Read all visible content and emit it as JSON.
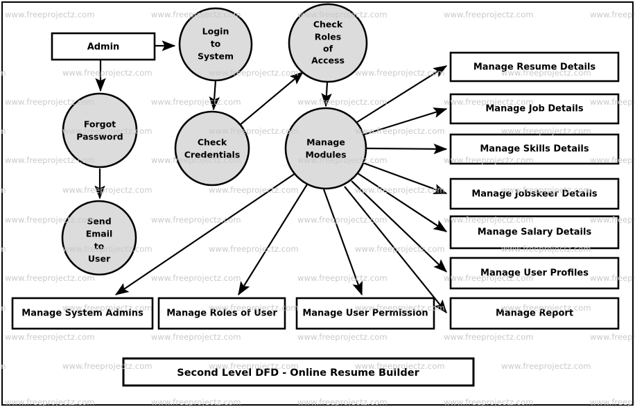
{
  "diagram": {
    "title": "Second Level DFD - Online Resume Builder",
    "watermark": "www.freeprojectz.com",
    "colors": {
      "process_fill": "#dcdcdc",
      "entity_fill": "#ffffff",
      "stroke": "#000000",
      "watermark": "#c9c9c9",
      "background": "#ffffff"
    },
    "entities": {
      "admin": "Admin"
    },
    "processes": {
      "login_to_system": [
        "Login",
        "to",
        "System"
      ],
      "check_roles_of_access": [
        "Check",
        "Roles",
        "of",
        "Access"
      ],
      "forgot_password": [
        "Forgot",
        "Password"
      ],
      "check_credentials": [
        "Check",
        "Credentials"
      ],
      "manage_modules": [
        "Manage",
        "Modules"
      ],
      "send_email_to_user": [
        "Send",
        "Email",
        "to",
        "User"
      ]
    },
    "right_boxes": [
      "Manage Resume Details",
      "Manage Job Details",
      "Manage Skills Details",
      "Manage Jobskeer Details",
      "Manage Salary Details",
      "Manage User Profiles",
      "Manage Report"
    ],
    "bottom_boxes": [
      "Manage System Admins",
      "Manage Roles of User",
      "Manage User Permission"
    ],
    "flows": [
      {
        "from": "Admin",
        "to": "Login to System"
      },
      {
        "from": "Admin",
        "to": "Forgot Password"
      },
      {
        "from": "Forgot Password",
        "to": "Send Email to User"
      },
      {
        "from": "Login to System",
        "to": "Check Credentials"
      },
      {
        "from": "Check Credentials",
        "to": "Check Roles of Access"
      },
      {
        "from": "Check Roles of Access",
        "to": "Manage Modules"
      },
      {
        "from": "Manage Modules",
        "to": "Manage Resume Details"
      },
      {
        "from": "Manage Modules",
        "to": "Manage Job Details"
      },
      {
        "from": "Manage Modules",
        "to": "Manage Skills Details"
      },
      {
        "from": "Manage Modules",
        "to": "Manage Jobskeer Details"
      },
      {
        "from": "Manage Modules",
        "to": "Manage Salary Details"
      },
      {
        "from": "Manage Modules",
        "to": "Manage User Profiles"
      },
      {
        "from": "Manage Modules",
        "to": "Manage Report"
      },
      {
        "from": "Manage Modules",
        "to": "Manage System Admins"
      },
      {
        "from": "Manage Modules",
        "to": "Manage Roles of User"
      },
      {
        "from": "Manage Modules",
        "to": "Manage User Permission"
      }
    ]
  }
}
